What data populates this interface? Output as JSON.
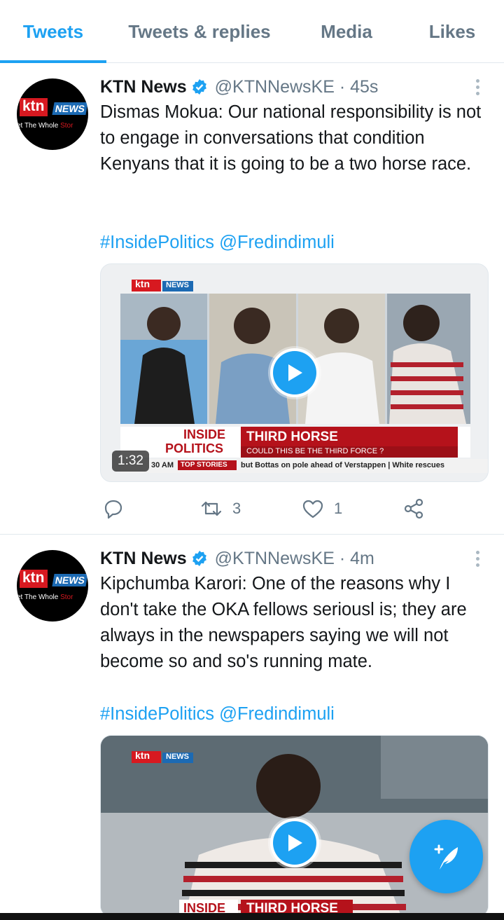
{
  "tabs": [
    {
      "label": "Tweets",
      "active": true
    },
    {
      "label": "Tweets & replies",
      "active": false
    },
    {
      "label": "Media",
      "active": false
    },
    {
      "label": "Likes",
      "active": false
    }
  ],
  "colors": {
    "accent": "#1da1f2",
    "muted": "#657786",
    "brand_red": "#d71920",
    "brand_blue": "#1c6ab3"
  },
  "avatar": {
    "ktn": "ktn",
    "news": "NEWS",
    "tagline_a": "et The Whole ",
    "tagline_b": "Stor"
  },
  "tweets": [
    {
      "display_name": "KTN News",
      "handle": "@KTNNewsKE · 45s",
      "text": "Dismas Mokua: Our national responsibility is not to engage in conversations that condition Kenyans that it is going to be a two horse race.",
      "links": "#InsidePolitics @Fredindimuli",
      "media": {
        "duration": "1:32",
        "logo_ktn": "ktn",
        "logo_news": "NEWS",
        "lower_third_left_1": "INSIDE",
        "lower_third_left_2": "POLITICS",
        "lower_third_title": "THIRD HORSE",
        "lower_third_sub": "COULD THIS BE THE THIRD FORCE ?",
        "ticker_time": "30 AM",
        "ticker_tag": "TOP STORIES",
        "ticker_text": "but Bottas on pole ahead of Verstappen  |  White rescues"
      },
      "reply_count": "",
      "retweet_count": "3",
      "like_count": "1"
    },
    {
      "display_name": "KTN News",
      "handle": "@KTNNewsKE · 4m",
      "text": "Kipchumba Karori: One of the reasons why I don't take the OKA fellows seriousl is; they are always in the newspapers saying we will not become so and so's running mate.",
      "links": "#InsidePolitics @Fredindimuli",
      "media": {
        "logo_ktn": "ktn",
        "logo_news": "NEWS",
        "lower_third_left_1": "INSIDE",
        "lower_third_title": "THIRD HORSE"
      }
    }
  ]
}
